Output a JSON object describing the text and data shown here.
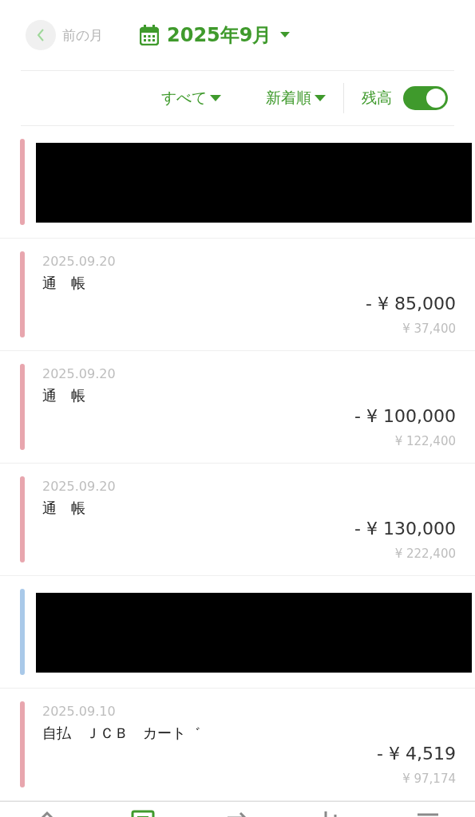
{
  "header": {
    "prev_label": "前の月",
    "month": "2025年9月"
  },
  "filters": {
    "category": "すべて",
    "sort": "新着順",
    "balance_label": "残高",
    "balance_on": true
  },
  "transactions": [
    {
      "kind": "redacted",
      "color": "#e8a6ae"
    },
    {
      "kind": "entry",
      "color": "#e8a6ae",
      "date": "2025.09.20",
      "name": "通　帳",
      "amount": "- ¥ 85,000",
      "balance": "¥ 37,400"
    },
    {
      "kind": "entry",
      "color": "#e8a6ae",
      "date": "2025.09.20",
      "name": "通　帳",
      "amount": "- ¥ 100,000",
      "balance": "¥ 122,400"
    },
    {
      "kind": "entry",
      "color": "#e8a6ae",
      "date": "2025.09.20",
      "name": "通　帳",
      "amount": "- ¥ 130,000",
      "balance": "¥ 222,400"
    },
    {
      "kind": "redacted",
      "color": "#a9c9e9"
    },
    {
      "kind": "entry",
      "color": "#e8a6ae",
      "date": "2025.09.10",
      "name": "自払　ＪＣＢ　カート゛",
      "amount": "- ¥ 4,519",
      "balance": "¥ 97,174"
    }
  ],
  "nav": [
    {
      "kind": "home",
      "selected": false
    },
    {
      "kind": "list",
      "selected": true
    },
    {
      "kind": "transfer",
      "selected": false
    },
    {
      "kind": "chart",
      "selected": false
    },
    {
      "kind": "menu",
      "selected": false
    }
  ]
}
